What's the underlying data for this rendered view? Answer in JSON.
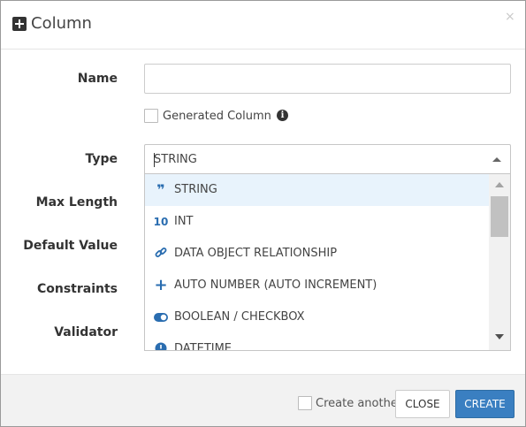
{
  "modal": {
    "title": "Column",
    "close_glyph": "×"
  },
  "form": {
    "name_label": "Name",
    "name_value": "",
    "generated_column_label": "Generated Column",
    "generated_column_checked": false,
    "info_glyph": "i",
    "type_label": "Type",
    "type_value": "STRING",
    "max_length_label": "Max Length",
    "default_value_label": "Default Value",
    "constraints_label": "Constraints",
    "validator_label": "Validator"
  },
  "dropdown": {
    "options": [
      {
        "icon": "quote-icon",
        "glyph": "❞",
        "label": "STRING",
        "selected": true
      },
      {
        "icon": "number-10-icon",
        "glyph": "10",
        "label": "INT",
        "selected": false
      },
      {
        "icon": "link-icon",
        "glyph": "🔗",
        "label": "DATA OBJECT RELATIONSHIP",
        "selected": false
      },
      {
        "icon": "plus-icon",
        "glyph": "+",
        "label": "AUTO NUMBER (AUTO INCREMENT)",
        "selected": false
      },
      {
        "icon": "toggle-icon",
        "glyph": "◉",
        "label": "BOOLEAN / CHECKBOX",
        "selected": false
      },
      {
        "icon": "clock-icon",
        "glyph": "●",
        "label": "DATETIME",
        "selected": false
      }
    ]
  },
  "footer": {
    "create_another_label": "Create another",
    "create_another_checked": false,
    "close_label": "CLOSE",
    "create_label": "CREATE"
  },
  "colors": {
    "accent": "#3a7fc1",
    "icon_blue": "#2a6db0",
    "selected_bg": "#e8f3fc"
  }
}
